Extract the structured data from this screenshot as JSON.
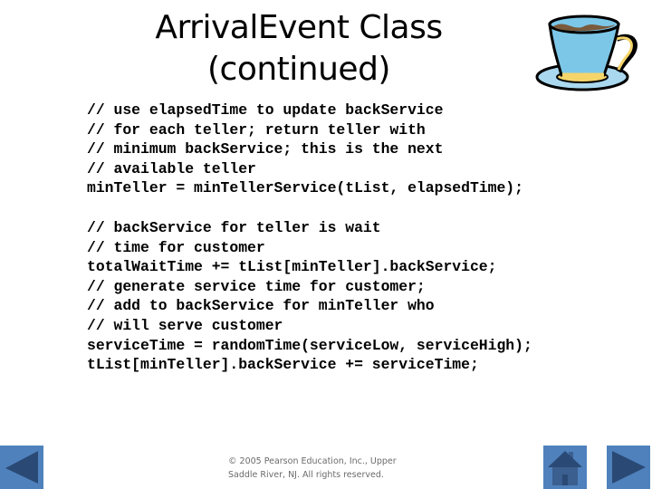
{
  "slide": {
    "title_line1": "ArrivalEvent Class",
    "title_line2": "(continued)",
    "decoration_icon": "teacup-icon",
    "code_block_1": [
      "// use elapsedTime to update backService",
      "// for each teller; return teller with",
      "// minimum backService; this is the next",
      "// available teller",
      "minTeller = minTellerService(tList, elapsedTime);"
    ],
    "code_block_2": [
      "// backService for teller is wait",
      "// time for customer",
      "totalWaitTime += tList[minTeller].backService;",
      "// generate service time for customer;",
      "// add to backService for minTeller who",
      "// will serve customer",
      "serviceTime = randomTime(serviceLow, serviceHigh);",
      "tList[minTeller].backService += serviceTime;"
    ],
    "footer_line1": "© 2005 Pearson Education, Inc., Upper",
    "footer_line2": "Saddle River, NJ.  All rights reserved."
  },
  "navigation": {
    "previous_icon": "triangle-left-icon",
    "home_icon": "house-icon",
    "next_icon": "triangle-right-icon"
  },
  "colors": {
    "nav_button": "#4f81bd",
    "nav_glyph": "#2a4a75",
    "footer_text": "#6b6b6b"
  }
}
